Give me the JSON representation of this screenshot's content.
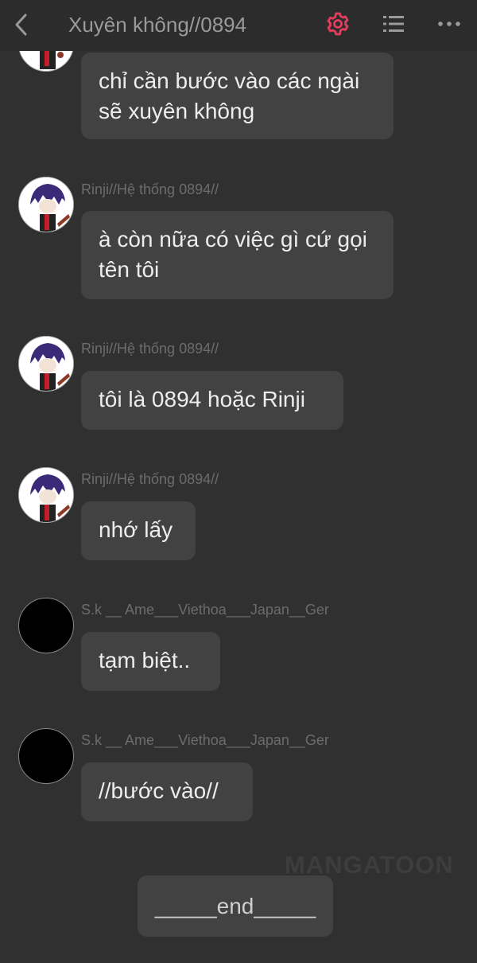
{
  "header": {
    "title": "Xuyên không//0894",
    "back_icon": "chevron-left-icon",
    "settings_icon": "gear-icon",
    "settings_color": "#e23d5c",
    "list_icon": "list-icon",
    "more_icon": "more-horizontal-icon"
  },
  "messages": [
    {
      "sender": "",
      "text": "chỉ cần bước vào các ngài sẽ xuyên không",
      "avatar": "anime-character"
    },
    {
      "sender": "Rinji//Hệ thống 0894//",
      "text": "à còn nữa có việc gì cứ gọi tên tôi",
      "avatar": "anime-character"
    },
    {
      "sender": "Rinji//Hệ thống 0894//",
      "text": "tôi là 0894 hoặc Rinji",
      "avatar": "anime-character"
    },
    {
      "sender": "Rinji//Hệ thống 0894//",
      "text": "nhớ lấy",
      "avatar": "anime-character"
    },
    {
      "sender": "S.k __ Ame___Viethoa___Japan__Ger",
      "text": "tạm biệt..",
      "avatar": "black-circle"
    },
    {
      "sender": "S.k __ Ame___Viethoa___Japan__Ger",
      "text": "//bước vào//",
      "avatar": "black-circle"
    }
  ],
  "watermark": "MANGATOON",
  "end_label": "_____end_____"
}
